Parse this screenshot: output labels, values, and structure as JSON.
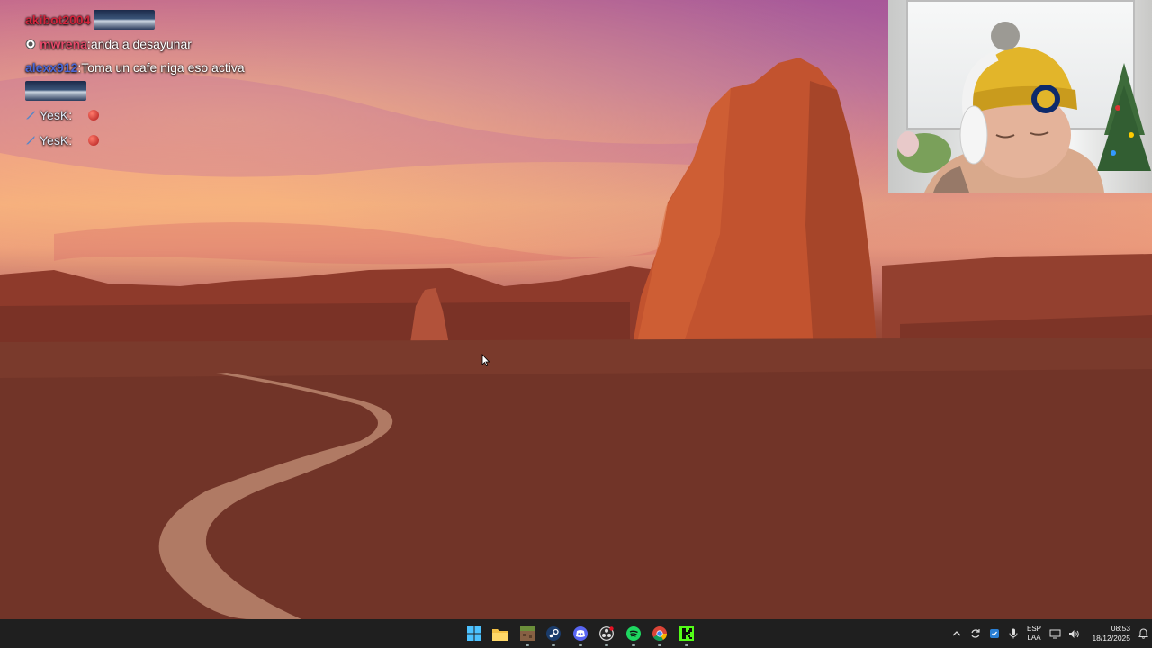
{
  "chat": {
    "messages": [
      {
        "user": "akibot2004",
        "sep": "",
        "text": "",
        "has_emote": true
      },
      {
        "user": "mwrena",
        "sep": ": ",
        "text": "anda a desayunar",
        "has_emote": false
      },
      {
        "user": "alexx912",
        "sep": ": ",
        "text": "Toma un cafe niga eso activa",
        "has_emote": false
      },
      {
        "user": "YesK",
        "sep": ":",
        "text": "",
        "has_emote": false
      },
      {
        "user": "YesK",
        "sep": ":",
        "text": "",
        "has_emote": false
      }
    ]
  },
  "taskbar": {
    "apps": [
      "start-icon",
      "file-explorer-icon",
      "minecraft-icon",
      "steam-icon",
      "discord-icon",
      "obs-icon",
      "spotify-icon",
      "chrome-icon",
      "kick-icon"
    ],
    "tray": {
      "lang_top": "ESP",
      "lang_bottom": "LAA",
      "time": "08:53",
      "date": "18/12/2025"
    }
  },
  "colors": {
    "taskbar_bg": "#1f1f1f",
    "user_red": "#d2243c",
    "user_blue": "#4a67d6",
    "user_pink": "#e54b6a"
  }
}
